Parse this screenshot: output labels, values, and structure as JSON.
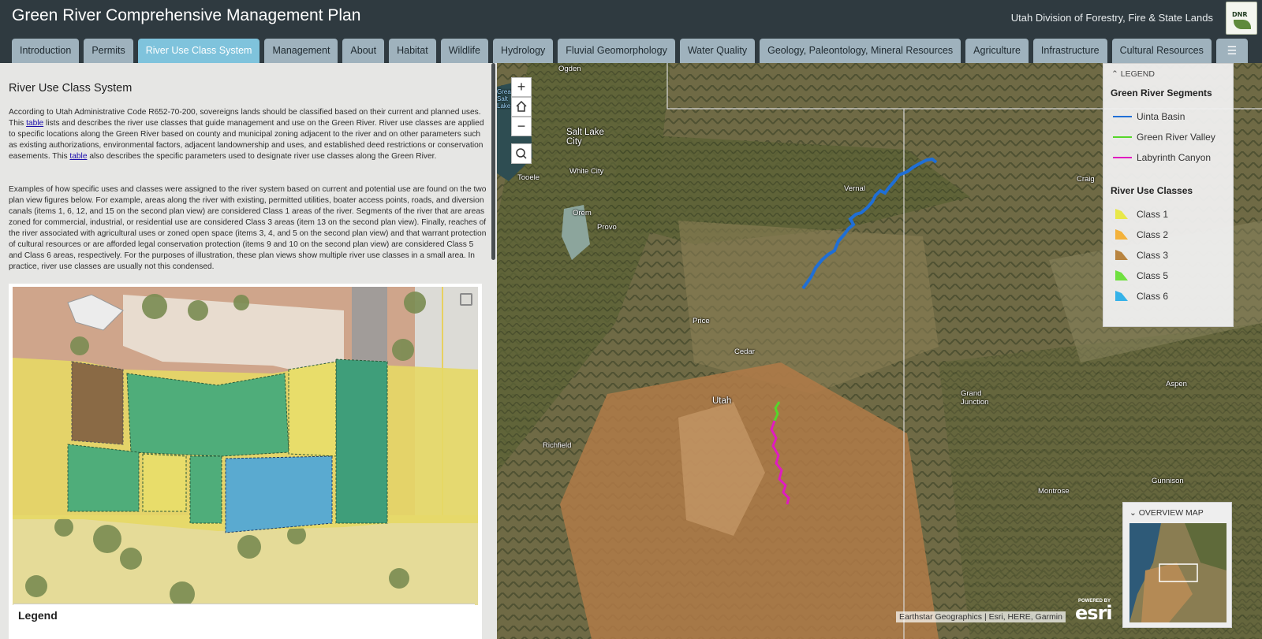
{
  "header": {
    "title": "Green River Comprehensive Management Plan",
    "agency": "Utah Division of Forestry, Fire & State Lands",
    "logo_text": "DNR"
  },
  "tabs": [
    {
      "label": "Introduction",
      "active": false
    },
    {
      "label": "Permits",
      "active": false
    },
    {
      "label": "River Use Class System",
      "active": true
    },
    {
      "label": "Management",
      "active": false
    },
    {
      "label": "About",
      "active": false
    },
    {
      "label": "Habitat",
      "active": false
    },
    {
      "label": "Wildlife",
      "active": false
    },
    {
      "label": "Hydrology",
      "active": false
    },
    {
      "label": "Fluvial Geomorphology",
      "active": false
    },
    {
      "label": "Water Quality",
      "active": false
    },
    {
      "label": "Geology, Paleontology, Mineral Resources",
      "active": false
    },
    {
      "label": "Agriculture",
      "active": false
    },
    {
      "label": "Infrastructure",
      "active": false
    },
    {
      "label": "Cultural Resources",
      "active": false
    }
  ],
  "menu_icon": "hamburger-menu-icon",
  "left": {
    "section_title": "River Use Class System",
    "p1_a": "According to Utah Administrative Code R652-70-200, sovereigns lands should be classified based on their current and planned uses. This ",
    "p1_link1": "table",
    "p1_b": " lists and describes the river use classes that guide management and use on the Green River. River use classes are applied to specific locations along the Green River based on county and municipal zoning adjacent to the river and on other parameters such as existing authorizations, environmental factors, adjacent landownership and uses, and established deed restrictions or conservation easements. This ",
    "p1_link2": "table",
    "p1_c": " also describes the specific parameters used to designate river use classes along the Green River.",
    "p2": "Examples of how specific uses and classes were assigned to the river system based on current and potential use are found on the two plan view figures below. For example, areas along the river with existing, permitted utilities, boater access points, roads, and diversion canals (items 1, 6, 12, and 15 on the second plan view) are considered Class 1 areas of the river. Segments of the river that are areas zoned for commercial, industrial, or residential use are considered Class 3 areas (item 13 on the second plan view). Finally, reaches of the river associated with agricultural uses or zoned open space (items 3, 4, and 5 on the second plan view) and that warrant protection of cultural resources or are afforded legal conservation protection (items 9 and 10 on the second plan view) are considered Class 5 and Class 6 areas, respectively. For the purposes of illustration, these plan views show multiple river use classes in a small area. In practice, river use classes are usually not this condensed.",
    "figure_legend": "Legend"
  },
  "map": {
    "places": [
      {
        "name": "Ogden"
      },
      {
        "name": "Great Salt Lake"
      },
      {
        "name": "Salt Lake City"
      },
      {
        "name": "Tooele"
      },
      {
        "name": "White City"
      },
      {
        "name": "Orem"
      },
      {
        "name": "Provo"
      },
      {
        "name": "Vernal"
      },
      {
        "name": "Craig"
      },
      {
        "name": "Price"
      },
      {
        "name": "Cedar"
      },
      {
        "name": "Utah"
      },
      {
        "name": "Richfield"
      },
      {
        "name": "Grand Junction"
      },
      {
        "name": "Aspen"
      },
      {
        "name": "Montrose"
      },
      {
        "name": "Gunnison"
      }
    ],
    "zoom_in": "+",
    "zoom_out": "−",
    "attribution": "Earthstar Geographics | Esri, HERE, Garmin",
    "esri_powered": "POWERED BY",
    "esri_name": "esri"
  },
  "legend": {
    "heading": "LEGEND",
    "segments_title": "Green River Segments",
    "segments": [
      {
        "label": "Uinta Basin",
        "color": "#1f6fd6"
      },
      {
        "label": "Green River Valley",
        "color": "#56d62a"
      },
      {
        "label": "Labyrinth Canyon",
        "color": "#e01bc0"
      }
    ],
    "classes_title": "River Use Classes",
    "classes": [
      {
        "label": "Class 1",
        "color": "#e8e84a"
      },
      {
        "label": "Class 2",
        "color": "#f3b23b"
      },
      {
        "label": "Class 3",
        "color": "#b8843f"
      },
      {
        "label": "Class 5",
        "color": "#6fe03f"
      },
      {
        "label": "Class 6",
        "color": "#35b2e8"
      }
    ]
  },
  "overview": {
    "heading": "OVERVIEW MAP"
  }
}
